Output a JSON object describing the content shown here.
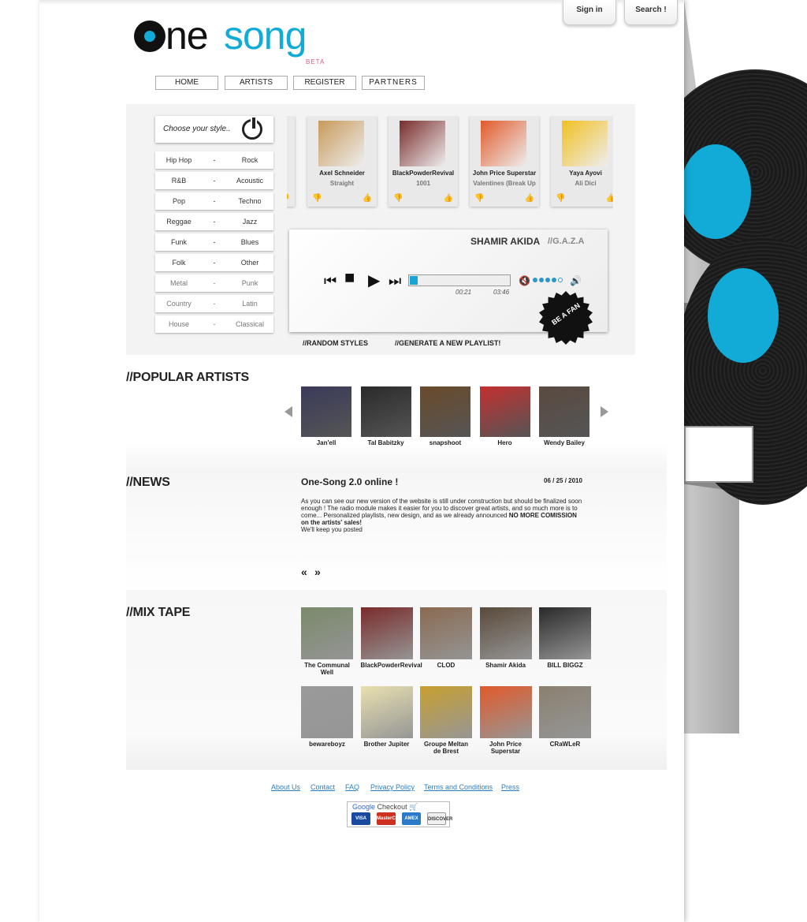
{
  "header": {
    "sign_in": "Sign in",
    "search": "Search !",
    "logo_one": "ne",
    "logo_song": "song",
    "logo_beta": "BETA"
  },
  "nav": [
    "HOME",
    "ARTISTS",
    "REGISTER",
    "PARTNERS"
  ],
  "styles": {
    "prompt": "Choose your style..",
    "rows": [
      {
        "left": "Hip Hop",
        "right": "Rock"
      },
      {
        "left": "R&B",
        "right": "Acoustic"
      },
      {
        "left": "Pop",
        "right": "Techno"
      },
      {
        "left": "Reggae",
        "right": "Jazz"
      },
      {
        "left": "Funk",
        "right": "Blues"
      },
      {
        "left": "Folk",
        "right": "Other"
      },
      {
        "left": "Metal",
        "right": "Punk"
      },
      {
        "left": "Country",
        "right": "Latin"
      },
      {
        "left": "House",
        "right": "Classical"
      }
    ],
    "separator": "-"
  },
  "playlist": [
    {
      "artist": "Axel Schneider",
      "track": "Straight",
      "color": "#c89a5a"
    },
    {
      "artist": "BlackPowderRevival",
      "track": "1001",
      "color": "#7a2b2b"
    },
    {
      "artist": "John Price Superstar",
      "track": "Valentines (Break Up",
      "color": "#e25a2a"
    },
    {
      "artist": "Yaya Ayovi",
      "track": "Ali Dici",
      "color": "#f2c020"
    }
  ],
  "player": {
    "artist": "SHAMIR AKIDA",
    "album_prefix": "//",
    "album": "G.A.Z.A",
    "elapsed": "00:21",
    "duration": "03:46",
    "progress": 0.08,
    "volume_level": 4,
    "volume_max": 5,
    "fan_label": "BE A FAN",
    "random_styles": "//RANDOM STYLES",
    "generate_playlist": "//GENERATE A NEW PLAYLIST!"
  },
  "popular": {
    "title": "//POPULAR ARTISTS",
    "artists": [
      {
        "name": "Jan'ell",
        "color": "#3a3a5a"
      },
      {
        "name": "Tal Babitzky",
        "color": "#2a2a2a"
      },
      {
        "name": "snapshoot",
        "color": "#6a4a2a"
      },
      {
        "name": "Hero",
        "color": "#c43030"
      },
      {
        "name": "Wendy Bailey",
        "color": "#5a4a40"
      }
    ]
  },
  "news": {
    "title": "//NEWS",
    "headline": "One-Song 2.0 online !",
    "date": "06 / 25 / 2010",
    "body": "As you can see our new version of the website is still under construction but should be finalized soon enough ! The radio module makes it easier for you to discover great artists, and so much more is to come... Personalized playlists, new design, and as we already announced ",
    "body_bold": "NO MORE COMISSION on the artists' sales!",
    "body_end": "We'll keep you posted",
    "prev": "«",
    "next": "»"
  },
  "mixtape": {
    "title": "//MIX TAPE",
    "items": [
      {
        "name": "The Communal Well",
        "color": "#7a8a6a"
      },
      {
        "name": "BlackPowderRevival",
        "color": "#7a2b2b"
      },
      {
        "name": "CLOD",
        "color": "#8a6a50"
      },
      {
        "name": "Shamir Akida",
        "color": "#5a4a3a"
      },
      {
        "name": "BILL BIGGZ",
        "color": "#2a2a2a"
      },
      {
        "name": "bewareboyz",
        "color": "#9a9a9a"
      },
      {
        "name": "Brother Jupiter",
        "color": "#e8e0b0"
      },
      {
        "name": "Groupe Meltan de Brest",
        "color": "#c8a030"
      },
      {
        "name": "John Price Superstar",
        "color": "#e25a2a"
      },
      {
        "name": "CRaWLeR",
        "color": "#8a8070"
      }
    ]
  },
  "footer": {
    "links": [
      "About Us",
      "Contact",
      "FAQ",
      "Privacy Policy",
      "Terms and Conditions",
      "Press"
    ],
    "checkout_google": "Google",
    "checkout_label": "Checkout",
    "cards": [
      "VISA",
      "MasterCard",
      "AMEX",
      "DISCOVER"
    ]
  },
  "colors": {
    "accent": "#12aad6",
    "link": "#2a7fc0"
  }
}
